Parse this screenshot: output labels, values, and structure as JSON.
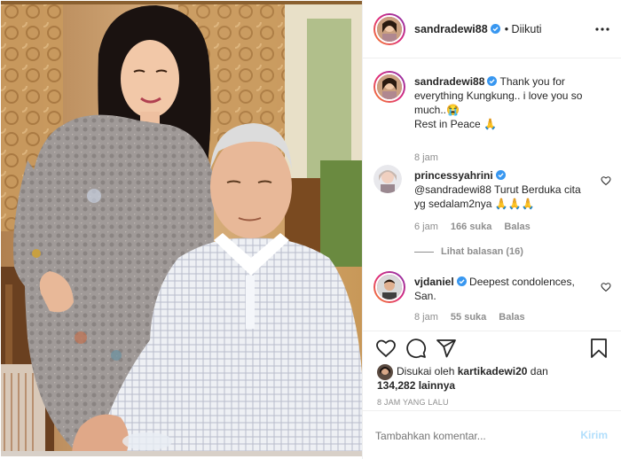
{
  "post": {
    "author": "sandradewi88",
    "follow_status": "• Diikuti",
    "caption": "Thank you for everything Kungkung.. i love you so much..😭",
    "caption_line2": "Rest in Peace 🙏",
    "caption_time": "8 jam"
  },
  "comments": [
    {
      "username": "princessyahrini",
      "text": "@sandradewi88 Turut Berduka cita yg sedalam2nya 🙏🙏🙏",
      "time": "6 jam",
      "likes": "166 suka",
      "reply": "Balas",
      "view_replies": "Lihat balasan (16)"
    },
    {
      "username": "vjdaniel",
      "text": "Deepest condolences, San.",
      "time": "8 jam",
      "likes": "55 suka",
      "reply": "Balas"
    }
  ],
  "likes_info": {
    "prefix": "Disukai oleh",
    "liker": "kartikadewi20",
    "connector": "dan",
    "others": "134,282 lainnya"
  },
  "timestamp": "8 JAM YANG LALU",
  "comment_box": {
    "placeholder": "Tambahkan komentar...",
    "submit": "Kirim"
  },
  "icons": {
    "more": "more-icon",
    "like": "heart-icon",
    "comment": "comment-icon",
    "share": "share-icon",
    "save": "bookmark-icon",
    "emoji": "emoji-icon"
  },
  "colors": {
    "verified": "#3897f0",
    "link_disabled": "#b2dffc",
    "muted": "#8e8e8e"
  }
}
